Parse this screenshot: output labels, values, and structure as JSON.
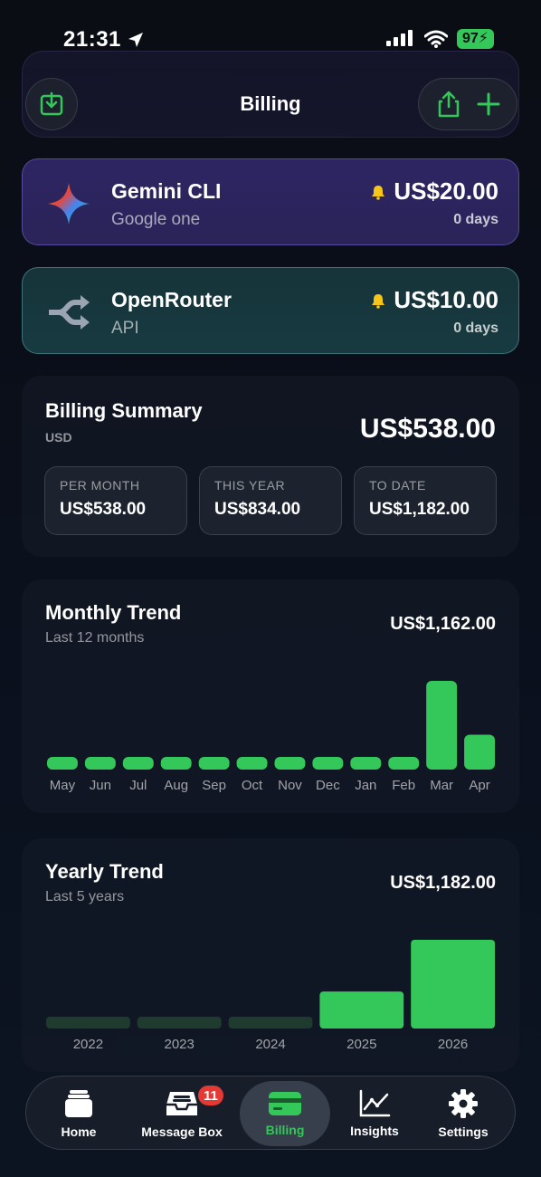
{
  "status_bar": {
    "time": "21:31",
    "battery": "97"
  },
  "header": {
    "title": "Billing"
  },
  "subscriptions": [
    {
      "name": "Gemini CLI",
      "kind": "Google one",
      "price": "US$20.00",
      "days": "0 days",
      "logo": "gemini-sparkle-icon",
      "accent": "#2d2563"
    },
    {
      "name": "OpenRouter",
      "kind": "API",
      "price": "US$10.00",
      "days": "0 days",
      "logo": "openrouter-icon",
      "accent": "#16343a"
    }
  ],
  "summary": {
    "title": "Billing Summary",
    "currency": "USD",
    "total": "US$538.00",
    "stats": [
      {
        "label": "PER MONTH",
        "value": "US$538.00"
      },
      {
        "label": "THIS YEAR",
        "value": "US$834.00"
      },
      {
        "label": "TO DATE",
        "value": "US$1,182.00"
      }
    ]
  },
  "monthly_trend": {
    "title": "Monthly Trend",
    "subtitle": "Last 12 months",
    "total": "US$1,162.00"
  },
  "yearly_trend": {
    "title": "Yearly Trend",
    "subtitle": "Last 5 years",
    "total": "US$1,182.00"
  },
  "chart_data": [
    {
      "type": "bar",
      "categories": [
        "May",
        "Jun",
        "Jul",
        "Aug",
        "Sep",
        "Oct",
        "Nov",
        "Dec",
        "Jan",
        "Feb",
        "Mar",
        "Apr"
      ],
      "values": [
        0,
        0,
        0,
        0,
        0,
        0,
        0,
        0,
        0,
        0,
        834,
        328
      ],
      "colors": {
        "bar": "#34c759"
      }
    },
    {
      "type": "bar",
      "categories": [
        "2022",
        "2023",
        "2024",
        "2025",
        "2026"
      ],
      "values": [
        0,
        0,
        0,
        348,
        834
      ],
      "colors": {
        "bar": "#34c759",
        "empty": "#1f3a2e"
      }
    }
  ],
  "tabbar": {
    "items": [
      {
        "label": "Home",
        "icon": "stack-icon"
      },
      {
        "label": "Message Box",
        "icon": "inbox-icon",
        "badge": "11"
      },
      {
        "label": "Billing",
        "icon": "credit-card-icon"
      },
      {
        "label": "Insights",
        "icon": "line-chart-icon"
      },
      {
        "label": "Settings",
        "icon": "gear-icon"
      }
    ],
    "active": "Billing"
  }
}
